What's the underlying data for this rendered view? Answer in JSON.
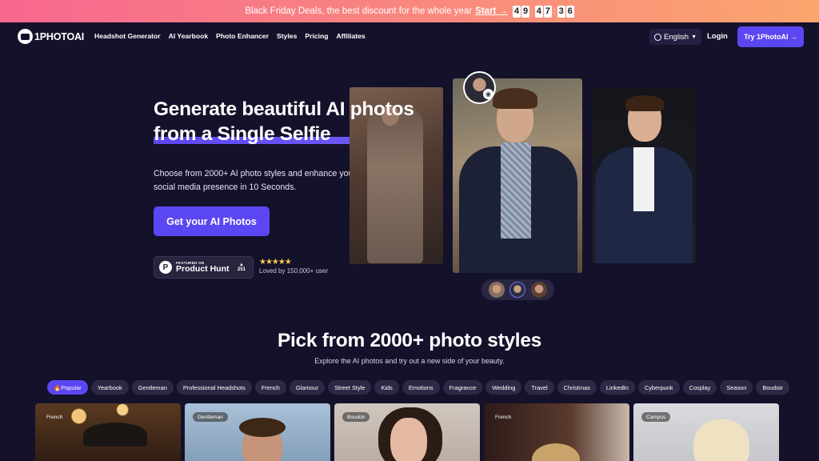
{
  "promo": {
    "text": "Black Friday Deals, the best discount for the whole year",
    "link": "Start →",
    "countdown": [
      "4",
      "9",
      "4",
      "7",
      "3",
      "6"
    ],
    "separator": ":"
  },
  "nav": {
    "logo": "1PHOTOAI",
    "items": [
      "Headshot Generator",
      "AI Yearbook",
      "Photo Enhancer",
      "Styles",
      "Pricing",
      "Affiliates"
    ],
    "language": "English",
    "login": "Login",
    "try": "Try 1PhotoAI →"
  },
  "hero": {
    "title_line1": "Generate beautiful AI photos",
    "title_line2": "from a Single Selfie",
    "subtitle": "Choose from 2000+ AI photo styles and enhance your social media presence in 10 Seconds.",
    "cta": "Get your AI Photos",
    "producthunt": {
      "featured": "FEATURED ON",
      "name": "Product Hunt",
      "votes": "251",
      "arrow": "▲"
    },
    "stars": "★★★★★",
    "loved": "Loved by 150,000+ user"
  },
  "styles": {
    "title": "Pick from 2000+ photo styles",
    "subtitle": "Explore the AI photos and try out a new side of your beauty.",
    "chips": [
      "🔥Popular",
      "Yearbook",
      "Gentleman",
      "Professional Headshots",
      "French",
      "Glamour",
      "Street Style",
      "Kids",
      "Emotions",
      "Fragrance",
      "Wedding",
      "Travel",
      "Christmas",
      "LinkedIn",
      "Cyberpunk",
      "Cosplay",
      "Season",
      "Boudoir"
    ],
    "cards": [
      "French",
      "Gentleman",
      "Boudoir",
      "French",
      "Campus"
    ]
  },
  "colors": {
    "accent": "#5b47f2",
    "background": "#14112b",
    "promo_start": "#f7678f",
    "promo_end": "#fba66e"
  }
}
